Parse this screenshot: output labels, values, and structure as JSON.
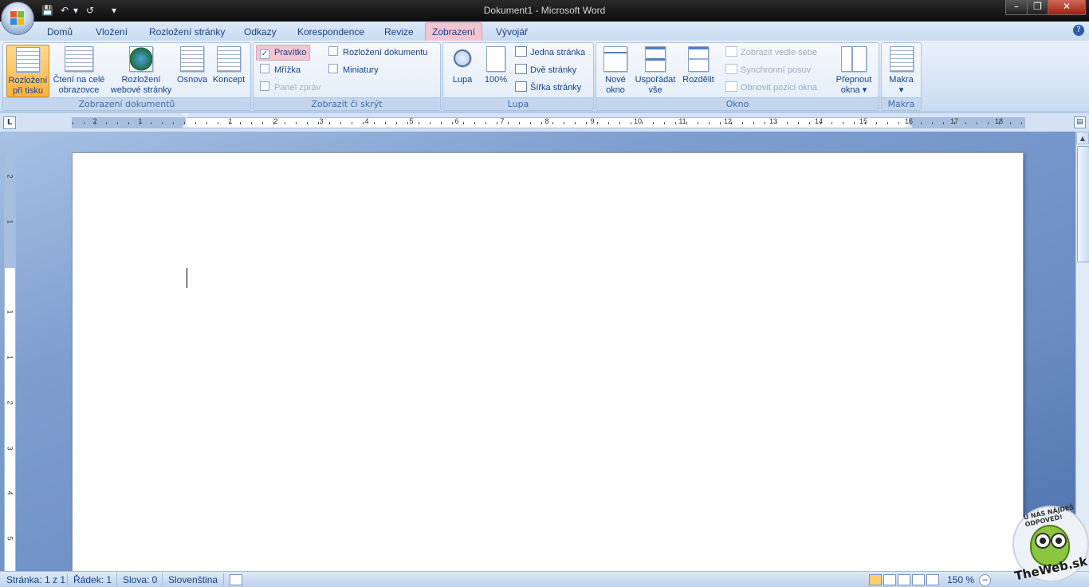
{
  "window": {
    "title": "Dokument1 - Microsoft Word",
    "minimize": "–",
    "restore": "❐",
    "close": "✕"
  },
  "qat": {
    "save": "💾",
    "undo": "↶",
    "undo_dd": "▾",
    "redo": "↺",
    "customize": "▾"
  },
  "tabs": [
    "Domů",
    "Vložení",
    "Rozložení stránky",
    "Odkazy",
    "Korespondence",
    "Revize",
    "Zobrazení",
    "Vývojář"
  ],
  "active_tab": "Zobrazení",
  "help": "?",
  "ribbon": {
    "document_views": {
      "label": "Zobrazení dokumentů",
      "print_layout": [
        "Rozložení",
        "při tisku"
      ],
      "full_screen": [
        "Čtení na celé",
        "obrazovce"
      ],
      "web_layout": [
        "Rozložení",
        "webové stránky"
      ],
      "outline": "Osnova",
      "draft": "Koncept"
    },
    "show_hide": {
      "label": "Zobrazit či skrýt",
      "ruler": "Pravítko",
      "gridlines": "Mřížka",
      "message_bar": "Panel zpráv",
      "document_map": "Rozložení dokumentu",
      "thumbnails": "Miniatury"
    },
    "zoom": {
      "label": "Lupa",
      "zoom": "Lupa",
      "hundred": "100%",
      "one_page": "Jedna stránka",
      "two_pages": "Dvě stránky",
      "page_width": "Šířka stránky"
    },
    "window_group": {
      "label": "Okno",
      "new_window": [
        "Nové",
        "okno"
      ],
      "arrange_all": [
        "Uspořádat",
        "vše"
      ],
      "split": "Rozdělit",
      "side_by_side": "Zobrazit vedle sebe",
      "sync_scroll": "Synchronní posuv",
      "reset_position": "Obnovit pozici okna",
      "switch_windows": [
        "Přepnout",
        "okna ▾"
      ]
    },
    "macros": {
      "label": "Makra",
      "macros": "Makra",
      "macros_dd": "▾"
    }
  },
  "ruler": {
    "tab_selector": "L",
    "numbers": [
      "2",
      "1",
      "1",
      "2",
      "3",
      "4",
      "5",
      "6",
      "7",
      "8",
      "9",
      "10",
      "11",
      "12",
      "13",
      "14",
      "15",
      "16",
      "17",
      "18"
    ],
    "vertical_numbers": [
      "2",
      "1",
      "1",
      "1",
      "2",
      "3",
      "4",
      "5",
      "6"
    ]
  },
  "status": {
    "page": "Stránka: 1 z 1",
    "line": "Řádek: 1",
    "words": "Slova: 0",
    "language": "Slovenština",
    "zoom": "150 %",
    "zoom_out": "−"
  },
  "watermark": {
    "arc_text": "U NÁS NÁJDEŠ ODPOVEĎ!",
    "brand": "TheWeb.sk"
  },
  "colors": {
    "active_tab": "#f3c5d2",
    "selected_button": "#ffb33e",
    "ribbon": "#dbe6f5"
  }
}
